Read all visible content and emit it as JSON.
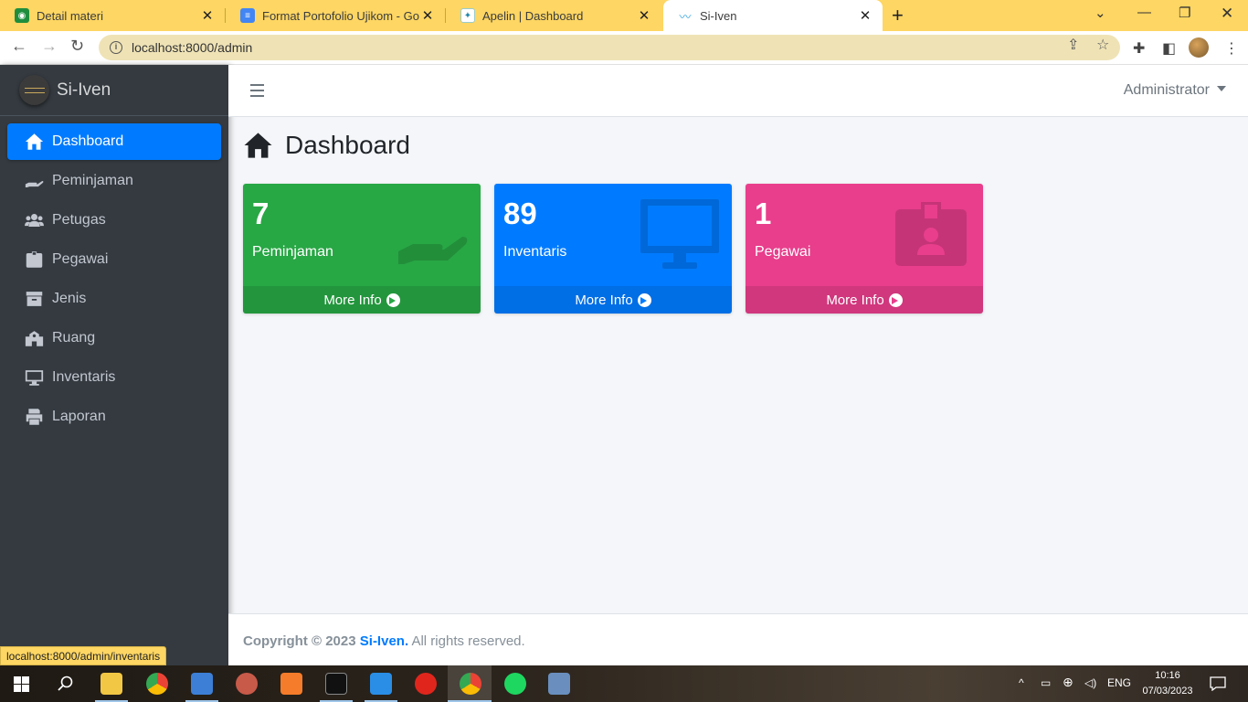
{
  "browser": {
    "tabs": [
      {
        "title": "Detail materi",
        "favicon": "classroom-icon",
        "active": false
      },
      {
        "title": "Format Portofolio Ujikom - Goog",
        "favicon": "docs-icon",
        "active": false
      },
      {
        "title": "Apelin | Dashboard",
        "favicon": "apelin-icon",
        "active": false
      },
      {
        "title": "Si-Iven",
        "favicon": "siiven-icon",
        "active": true
      }
    ],
    "url": "localhost:8000/admin",
    "status_url": "localhost:8000/admin/inventaris"
  },
  "app": {
    "brand": "Si-Iven",
    "user": "Administrator",
    "sidebar": {
      "items": [
        {
          "label": "Dashboard",
          "icon": "home-icon",
          "active": true
        },
        {
          "label": "Peminjaman",
          "icon": "hand-holding-icon",
          "active": false
        },
        {
          "label": "Petugas",
          "icon": "users-icon",
          "active": false
        },
        {
          "label": "Pegawai",
          "icon": "id-badge-icon",
          "active": false
        },
        {
          "label": "Jenis",
          "icon": "archive-icon",
          "active": false
        },
        {
          "label": "Ruang",
          "icon": "school-icon",
          "active": false
        },
        {
          "label": "Inventaris",
          "icon": "desktop-icon",
          "active": false
        },
        {
          "label": "Laporan",
          "icon": "print-icon",
          "active": false
        }
      ]
    },
    "page_title": "Dashboard",
    "stats": [
      {
        "value": "7",
        "label": "Peminjaman",
        "more": "More Info",
        "color": "#28a745",
        "icon": "hand-holding-icon"
      },
      {
        "value": "89",
        "label": "Inventaris",
        "more": "More Info",
        "color": "#007bff",
        "icon": "desktop-icon"
      },
      {
        "value": "1",
        "label": "Pegawai",
        "more": "More Info",
        "color": "#e83e8c",
        "icon": "id-badge-icon"
      }
    ],
    "footer": {
      "copyright": "Copyright © 2023",
      "brand": "Si-Iven.",
      "rights": "All rights reserved."
    }
  },
  "taskbar": {
    "language": "ENG",
    "time": "10:16",
    "date": "07/03/2023"
  }
}
